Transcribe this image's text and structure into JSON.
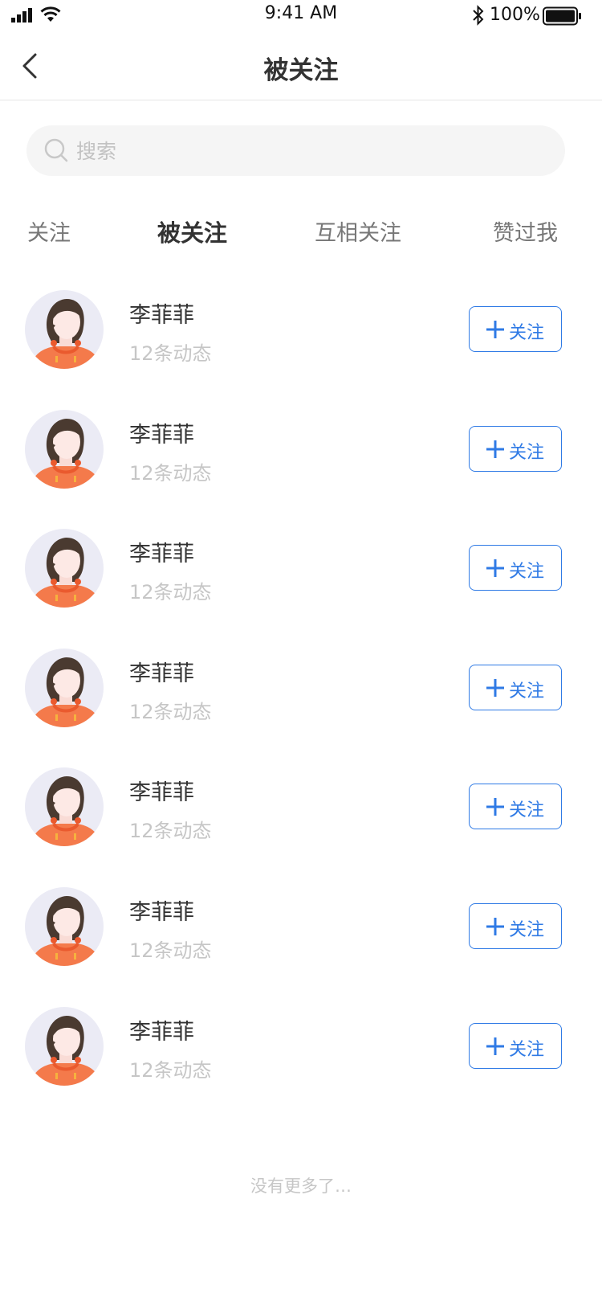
{
  "status_bar": {
    "time": "9:41 AM",
    "battery": "100%",
    "icons": [
      "signal-icon",
      "wifi-icon",
      "bluetooth-icon",
      "battery-icon"
    ]
  },
  "nav": {
    "title": "被关注",
    "back_icon": "chevron-left-icon"
  },
  "search": {
    "placeholder": "搜索",
    "value": ""
  },
  "tabs": [
    {
      "label": "关注",
      "active": false
    },
    {
      "label": "被关注",
      "active": true
    },
    {
      "label": "互相关注",
      "active": false
    },
    {
      "label": "赞过我",
      "active": false
    }
  ],
  "users": [
    {
      "name": "李菲菲",
      "sub": "12条动态",
      "button": "关注"
    },
    {
      "name": "李菲菲",
      "sub": "12条动态",
      "button": "关注"
    },
    {
      "name": "李菲菲",
      "sub": "12条动态",
      "button": "关注"
    },
    {
      "name": "李菲菲",
      "sub": "12条动态",
      "button": "关注"
    },
    {
      "name": "李菲菲",
      "sub": "12条动态",
      "button": "关注"
    },
    {
      "name": "李菲菲",
      "sub": "12条动态",
      "button": "关注"
    },
    {
      "name": "李菲菲",
      "sub": "12条动态",
      "button": "关注"
    }
  ],
  "footer": "没有更多了…",
  "colors": {
    "accent": "#2f7ae5",
    "text": "#333333",
    "muted": "#c6c6c6",
    "search_bg": "#f5f5f5",
    "avatar_bg": "#ebebf5",
    "avatar_shirt": "#f47a4b"
  }
}
